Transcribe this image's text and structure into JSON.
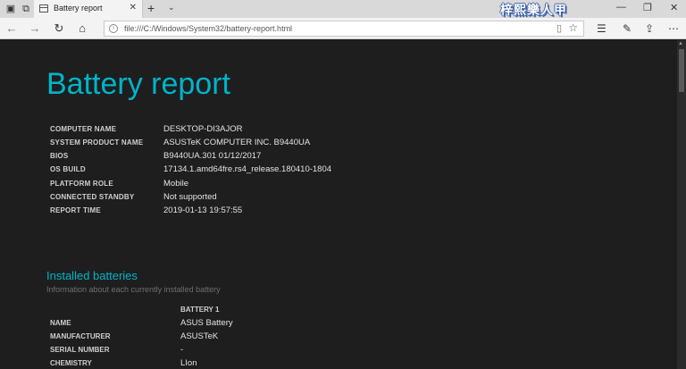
{
  "browser": {
    "tab": {
      "title": "Battery report",
      "close": "✕"
    },
    "new_tab": "+",
    "tab_menu": "⌄",
    "watermark": "梓熙樂人甲",
    "window_controls": {
      "minimize": "—",
      "restore": "❐",
      "close": "✕"
    },
    "nav": {
      "back": "←",
      "forward": "→",
      "refresh": "↻",
      "home": "⌂"
    },
    "address": "file:///C:/Windows/System32/battery-report.html",
    "icons": [
      "set-tabs-aside-icon",
      "tab-preview-icon",
      "favorites-icon",
      "reading-view-icon",
      "favorites-hub-icon",
      "pen-icon",
      "share-icon",
      "more-icon"
    ]
  },
  "report": {
    "title": "Battery report",
    "info": [
      {
        "key": "COMPUTER NAME",
        "value": "DESKTOP-DI3AJOR"
      },
      {
        "key": "SYSTEM PRODUCT NAME",
        "value": "ASUSTeK COMPUTER INC. B9440UA"
      },
      {
        "key": "BIOS",
        "value": "B9440UA.301 01/12/2017"
      },
      {
        "key": "OS BUILD",
        "value": "17134.1.amd64fre.rs4_release.180410-1804"
      },
      {
        "key": "PLATFORM ROLE",
        "value": "Mobile"
      },
      {
        "key": "CONNECTED STANDBY",
        "value": "Not supported"
      },
      {
        "key": "REPORT TIME",
        "value": "2019-01-13  19:57:55"
      }
    ],
    "installed": {
      "title": "Installed batteries",
      "subtitle": "Information about each currently installed battery",
      "column": "BATTERY 1",
      "rows": [
        {
          "key": "NAME",
          "value": "ASUS Battery"
        },
        {
          "key": "MANUFACTURER",
          "value": "ASUSTeK"
        },
        {
          "key": "SERIAL NUMBER",
          "value": "-"
        },
        {
          "key": "CHEMISTRY",
          "value": "LIon"
        }
      ]
    }
  }
}
